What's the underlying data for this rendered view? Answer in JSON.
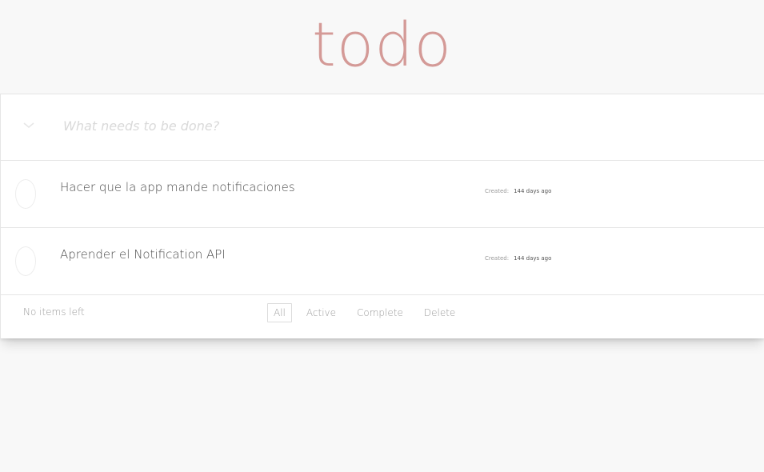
{
  "header": {
    "title": "todo"
  },
  "new_todo": {
    "placeholder": "What needs to be done?",
    "value": ""
  },
  "todos": [
    {
      "text": "Hacer que la app mande notificaciones",
      "meta_label": "Created:",
      "meta_time": "144 days ago",
      "completed": false
    },
    {
      "text": "Aprender el Notification API",
      "meta_label": "Created:",
      "meta_time": "144 days ago",
      "completed": false
    }
  ],
  "footer": {
    "count_text": "No items left",
    "filters": [
      {
        "label": "All",
        "selected": true
      },
      {
        "label": "Active",
        "selected": false
      },
      {
        "label": "Complete",
        "selected": false
      },
      {
        "label": "Delete",
        "selected": false
      }
    ]
  },
  "colors": {
    "title": "#d49a97",
    "background": "#f8f8f8",
    "panel": "#ffffff",
    "border": "#e6e6e6",
    "muted_text": "#9a9a9a"
  },
  "icons": {
    "toggle_all": "chevron-down-icon",
    "item_checkbox": "circle-checkbox-icon"
  }
}
